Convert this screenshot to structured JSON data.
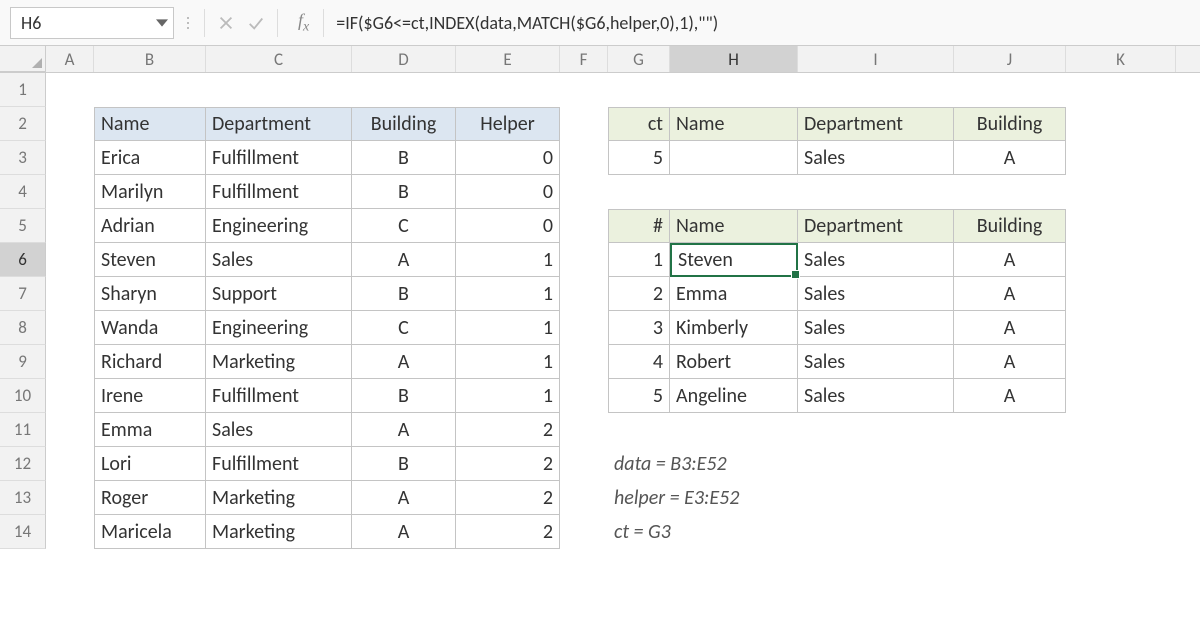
{
  "name_box": "H6",
  "formula": "=IF($G6<=ct,INDEX(data,MATCH($G6,helper,0),1),\"\")",
  "columns": [
    "A",
    "B",
    "C",
    "D",
    "E",
    "F",
    "G",
    "H",
    "I",
    "J",
    "K"
  ],
  "rows": [
    "1",
    "2",
    "3",
    "4",
    "5",
    "6",
    "7",
    "8",
    "9",
    "10",
    "11",
    "12",
    "13",
    "14"
  ],
  "left_table": {
    "headers": [
      "Name",
      "Department",
      "Building",
      "Helper"
    ],
    "data": [
      [
        "Erica",
        "Fulfillment",
        "B",
        "0"
      ],
      [
        "Marilyn",
        "Fulfillment",
        "B",
        "0"
      ],
      [
        "Adrian",
        "Engineering",
        "C",
        "0"
      ],
      [
        "Steven",
        "Sales",
        "A",
        "1"
      ],
      [
        "Sharyn",
        "Support",
        "B",
        "1"
      ],
      [
        "Wanda",
        "Engineering",
        "C",
        "1"
      ],
      [
        "Richard",
        "Marketing",
        "A",
        "1"
      ],
      [
        "Irene",
        "Fulfillment",
        "B",
        "1"
      ],
      [
        "Emma",
        "Sales",
        "A",
        "2"
      ],
      [
        "Lori",
        "Fulfillment",
        "B",
        "2"
      ],
      [
        "Roger",
        "Marketing",
        "A",
        "2"
      ],
      [
        "Maricela",
        "Marketing",
        "A",
        "2"
      ]
    ]
  },
  "criteria": {
    "headers": [
      "ct",
      "Name",
      "Department",
      "Building"
    ],
    "row": [
      "5",
      "",
      "Sales",
      "A"
    ]
  },
  "results": {
    "headers": [
      "#",
      "Name",
      "Department",
      "Building"
    ],
    "data": [
      [
        "1",
        "Steven",
        "Sales",
        "A"
      ],
      [
        "2",
        "Emma",
        "Sales",
        "A"
      ],
      [
        "3",
        "Kimberly",
        "Sales",
        "A"
      ],
      [
        "4",
        "Robert",
        "Sales",
        "A"
      ],
      [
        "5",
        "Angeline",
        "Sales",
        "A"
      ]
    ]
  },
  "notes": {
    "l1": "data = B3:E52",
    "l2": "helper = E3:E52",
    "l3": "ct = G3"
  }
}
